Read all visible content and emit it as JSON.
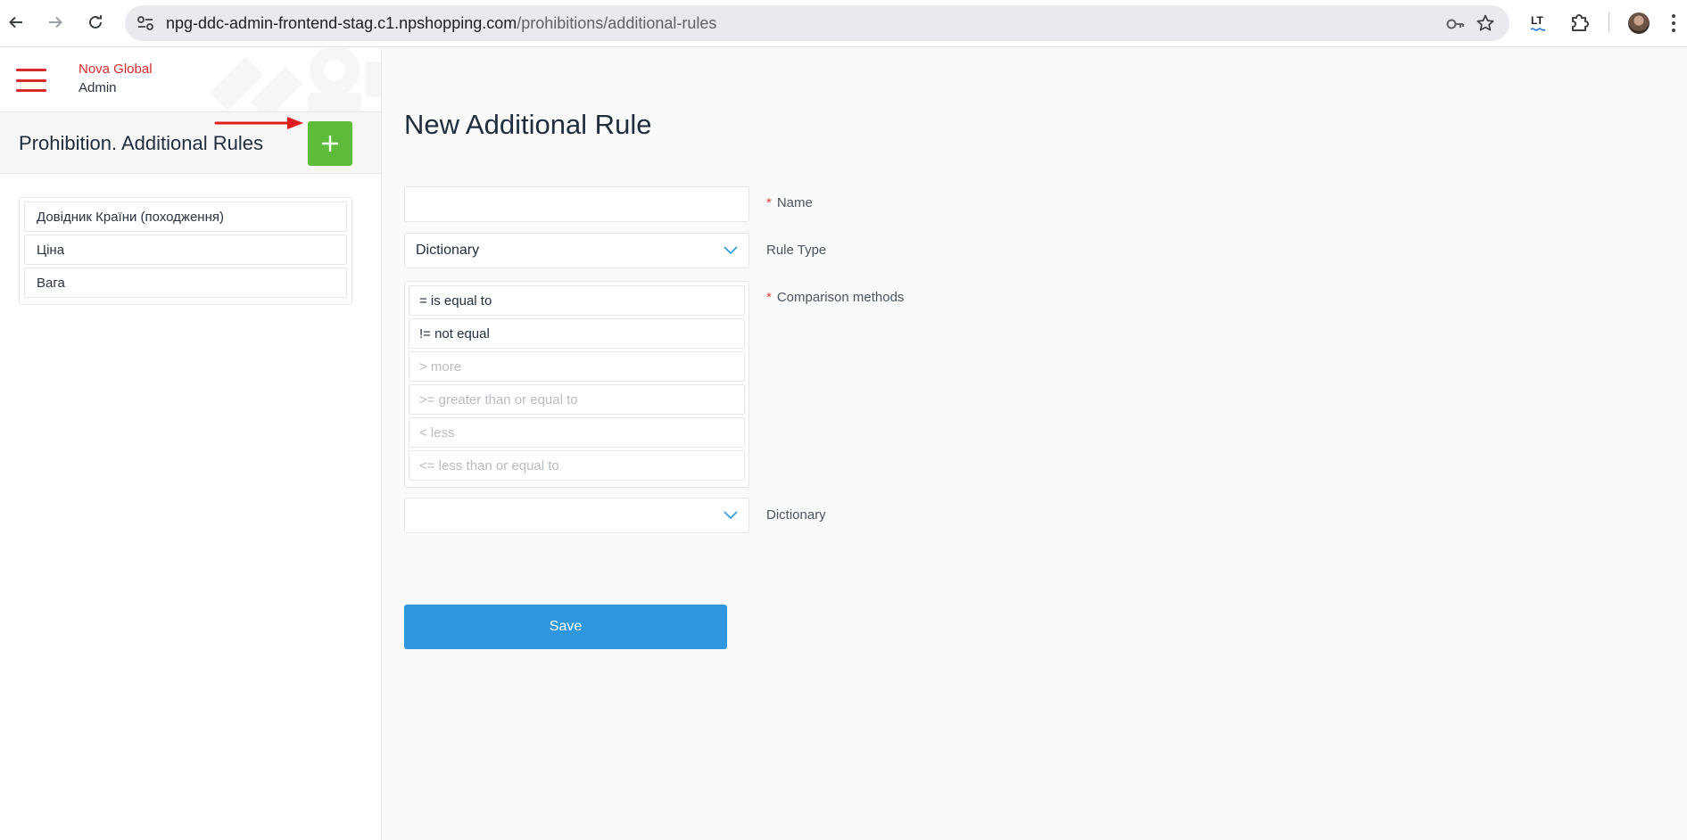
{
  "browser": {
    "url_host": "npg-ddc-admin-frontend-stag.c1.npshopping.com",
    "url_path": "/prohibitions/additional-rules",
    "back_icon": "arrow-left-icon",
    "forward_icon": "arrow-right-icon",
    "reload_icon": "reload-icon",
    "site_info_icon": "tune-icon",
    "password_icon": "key-icon",
    "bookmark_icon": "star-icon",
    "extension_badge": "LT",
    "extensions_icon": "puzzle-icon",
    "menu_icon": "kebab-icon"
  },
  "brand": {
    "name": "Nova Global",
    "sub": "Admin",
    "accent_color": "#d62b2b"
  },
  "sidebar": {
    "title": "Prohibition. Additional Rules",
    "add_icon": "plus-icon",
    "add_color": "#5dbd3a",
    "items": [
      {
        "label": "Довідник Країни (походження)"
      },
      {
        "label": "Ціна"
      },
      {
        "label": "Вага"
      }
    ]
  },
  "form": {
    "title": "New Additional Rule",
    "name": {
      "label": "Name",
      "required": "*",
      "value": ""
    },
    "rule_type": {
      "label": "Rule Type",
      "value": "Dictionary"
    },
    "comparison": {
      "label": "Comparison methods",
      "required": "*",
      "options": [
        {
          "label": "= is equal to",
          "state": "active"
        },
        {
          "label": "!= not equal",
          "state": "active"
        },
        {
          "label": "> more",
          "state": "inactive"
        },
        {
          "label": ">= greater than or equal to",
          "state": "inactive"
        },
        {
          "label": "< less",
          "state": "inactive"
        },
        {
          "label": "<= less than or equal to",
          "state": "inactive"
        }
      ]
    },
    "dictionary": {
      "label": "Dictionary",
      "value": ""
    },
    "save_label": "Save",
    "save_color": "#2f97e0"
  }
}
